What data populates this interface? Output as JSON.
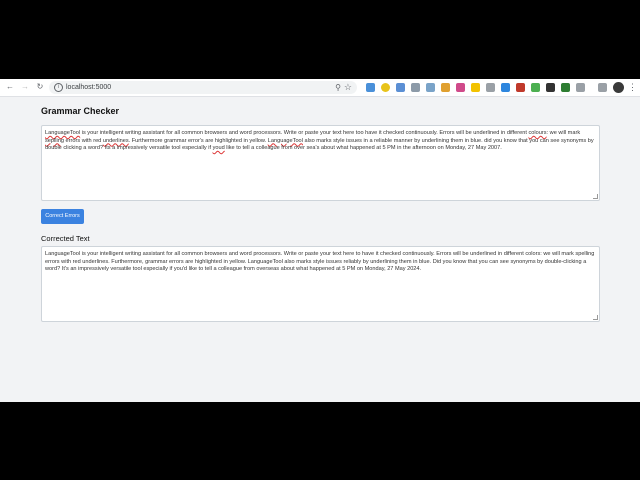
{
  "browser": {
    "url": "localhost:5000",
    "accent": "#3b82e0"
  },
  "page": {
    "heading": "Grammar Checker",
    "input_text": [
      {
        "t": "LanguageTool",
        "u": true
      },
      {
        "t": " is your intelligent writing assistant for all common browsers and word processors. Write or paste your text here too have it checked continuously. Errors will be underlined in different ",
        "u": false
      },
      {
        "t": "colours",
        "u": true
      },
      {
        "t": ": we will mark ",
        "u": false
      },
      {
        "t": "seplling",
        "u": true
      },
      {
        "t": " errors with red ",
        "u": false
      },
      {
        "t": "underlines",
        "u": true
      },
      {
        "t": ". Furthermore grammar error's are highlighted in yellow. ",
        "u": false
      },
      {
        "t": "LanguageTool",
        "u": true
      },
      {
        "t": " also marks style issues in a reliable manner by underlining them in blue. did you know that you can see synonyms by double clicking a word? Its a impressively versatile tool especially if ",
        "u": false
      },
      {
        "t": "youd",
        "u": true
      },
      {
        "t": " like to tell a colleague from over sea's about what happened at 5 PM in the afternoon on Monday, 27 May 2007.",
        "u": false
      }
    ],
    "correct_button": "Correct Errors",
    "corrected_label": "Corrected Text",
    "corrected_text": "LanguageTool is your intelligent writing assistant for all common browsers and word processors. Write or paste your text here to have it checked continuously. Errors will be underlined in different colors: we will mark spelling errors with red underlines. Furthermore, grammar errors are highlighted in yellow. LanguageTool also marks style issues reliably by underlining them in blue. Did you know that you can see synonyms by double-clicking a word? It's an impressively versatile tool especially if you'd like to tell a colleague from overseas about what happened at 5 PM on Monday, 27 May 2024."
  }
}
